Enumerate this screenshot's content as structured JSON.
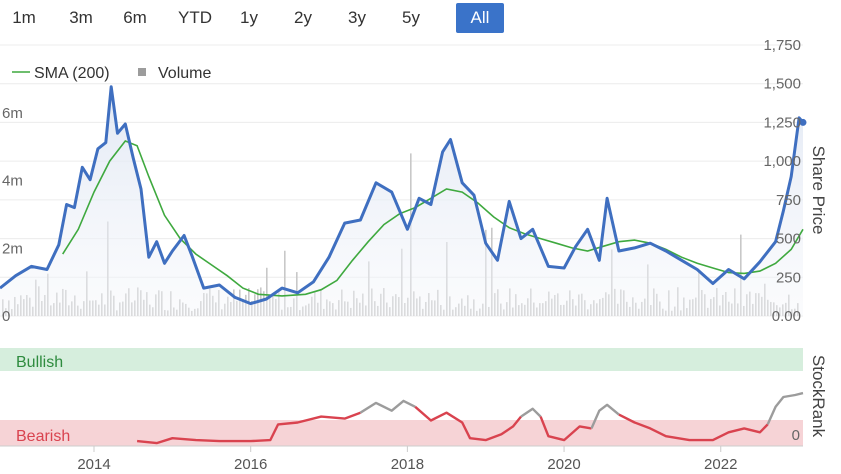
{
  "range_buttons": [
    {
      "label": "1m",
      "active": false
    },
    {
      "label": "3m",
      "active": false
    },
    {
      "label": "6m",
      "active": false
    },
    {
      "label": "YTD",
      "active": false
    },
    {
      "label": "1y",
      "active": false
    },
    {
      "label": "2y",
      "active": false
    },
    {
      "label": "3y",
      "active": false
    },
    {
      "label": "5y",
      "active": false
    },
    {
      "label": "All",
      "active": true
    }
  ],
  "colors": {
    "price": "#3f6fc0",
    "sma": "#3fa93f",
    "volume": "#c8c8c8",
    "bullish_band": "#d6eedd",
    "bearish_band": "#f6d3d6",
    "bullish_text": "#2e8b3e",
    "bearish_text": "#d9434f",
    "rank_red": "#d9434f",
    "rank_gray": "#9c9c9c",
    "active_button": "#3a73c9"
  },
  "chart_data": [
    {
      "type": "line",
      "legend": [
        {
          "name": "SMA (200)",
          "marker": "line"
        },
        {
          "name": "Volume",
          "marker": "square"
        }
      ],
      "legend_position": "top-left",
      "right_axis_title": "Share Price",
      "right_ticks": [
        "1,750",
        "1,500",
        "1,250",
        "1,000",
        "750",
        "500",
        "250",
        "0.00"
      ],
      "left_ticks": [
        "6m",
        "4m",
        "2m",
        "0"
      ],
      "x_ticks": [
        "2014",
        "2016",
        "2018",
        "2020",
        "2022"
      ],
      "ylim_price": [
        0,
        1750
      ],
      "ylim_volume": [
        0,
        8000000
      ],
      "series": [
        {
          "name": "Share Price",
          "points": [
            [
              2012.8,
              180
            ],
            [
              2013.0,
              260
            ],
            [
              2013.2,
              320
            ],
            [
              2013.4,
              300
            ],
            [
              2013.55,
              460
            ],
            [
              2013.65,
              720
            ],
            [
              2013.75,
              700
            ],
            [
              2013.85,
              960
            ],
            [
              2013.95,
              880
            ],
            [
              2014.05,
              1080
            ],
            [
              2014.15,
              1120
            ],
            [
              2014.22,
              1480
            ],
            [
              2014.3,
              1180
            ],
            [
              2014.4,
              1240
            ],
            [
              2014.5,
              1020
            ],
            [
              2014.6,
              820
            ],
            [
              2014.7,
              380
            ],
            [
              2014.8,
              480
            ],
            [
              2014.9,
              340
            ],
            [
              2015.0,
              420
            ],
            [
              2015.15,
              520
            ],
            [
              2015.25,
              390
            ],
            [
              2015.4,
              180
            ],
            [
              2015.6,
              200
            ],
            [
              2015.8,
              120
            ],
            [
              2016.0,
              80
            ],
            [
              2016.2,
              110
            ],
            [
              2016.4,
              180
            ],
            [
              2016.6,
              150
            ],
            [
              2016.8,
              220
            ],
            [
              2017.0,
              380
            ],
            [
              2017.2,
              600
            ],
            [
              2017.4,
              620
            ],
            [
              2017.6,
              860
            ],
            [
              2017.8,
              800
            ],
            [
              2018.0,
              560
            ],
            [
              2018.15,
              760
            ],
            [
              2018.3,
              720
            ],
            [
              2018.45,
              1060
            ],
            [
              2018.55,
              1140
            ],
            [
              2018.7,
              860
            ],
            [
              2018.85,
              780
            ],
            [
              2019.0,
              470
            ],
            [
              2019.15,
              360
            ],
            [
              2019.3,
              740
            ],
            [
              2019.45,
              500
            ],
            [
              2019.6,
              560
            ],
            [
              2019.8,
              320
            ],
            [
              2020.0,
              310
            ],
            [
              2020.15,
              450
            ],
            [
              2020.3,
              560
            ],
            [
              2020.45,
              360
            ],
            [
              2020.55,
              760
            ],
            [
              2020.7,
              420
            ],
            [
              2020.9,
              440
            ],
            [
              2021.1,
              470
            ],
            [
              2021.3,
              420
            ],
            [
              2021.5,
              360
            ],
            [
              2021.7,
              300
            ],
            [
              2021.9,
              210
            ],
            [
              2022.1,
              300
            ],
            [
              2022.3,
              240
            ],
            [
              2022.5,
              350
            ],
            [
              2022.7,
              480
            ],
            [
              2022.8,
              680
            ],
            [
              2022.9,
              900
            ],
            [
              2023.0,
              1280
            ],
            [
              2023.05,
              1250
            ]
          ]
        },
        {
          "name": "SMA (200)",
          "points": [
            [
              2013.6,
              400
            ],
            [
              2013.8,
              560
            ],
            [
              2014.0,
              800
            ],
            [
              2014.2,
              1000
            ],
            [
              2014.4,
              1130
            ],
            [
              2014.55,
              1100
            ],
            [
              2014.7,
              900
            ],
            [
              2014.9,
              650
            ],
            [
              2015.1,
              500
            ],
            [
              2015.3,
              400
            ],
            [
              2015.5,
              330
            ],
            [
              2015.7,
              260
            ],
            [
              2015.9,
              180
            ],
            [
              2016.1,
              140
            ],
            [
              2016.4,
              130
            ],
            [
              2016.7,
              140
            ],
            [
              2016.9,
              170
            ],
            [
              2017.1,
              230
            ],
            [
              2017.3,
              360
            ],
            [
              2017.5,
              480
            ],
            [
              2017.7,
              590
            ],
            [
              2017.9,
              660
            ],
            [
              2018.1,
              700
            ],
            [
              2018.3,
              760
            ],
            [
              2018.5,
              820
            ],
            [
              2018.7,
              800
            ],
            [
              2018.9,
              730
            ],
            [
              2019.1,
              640
            ],
            [
              2019.3,
              570
            ],
            [
              2019.5,
              530
            ],
            [
              2019.7,
              500
            ],
            [
              2019.9,
              470
            ],
            [
              2020.1,
              440
            ],
            [
              2020.3,
              420
            ],
            [
              2020.5,
              450
            ],
            [
              2020.7,
              480
            ],
            [
              2020.9,
              490
            ],
            [
              2021.1,
              470
            ],
            [
              2021.3,
              430
            ],
            [
              2021.5,
              380
            ],
            [
              2021.7,
              340
            ],
            [
              2021.9,
              310
            ],
            [
              2022.1,
              280
            ],
            [
              2022.3,
              275
            ],
            [
              2022.5,
              290
            ],
            [
              2022.7,
              340
            ],
            [
              2022.9,
              430
            ],
            [
              2023.05,
              560
            ]
          ]
        }
      ]
    },
    {
      "type": "line",
      "right_axis_title": "StockRank",
      "band_labels": [
        "Bullish",
        "Bearish"
      ],
      "right_ticks": [
        "0"
      ],
      "ylim": [
        0,
        100
      ],
      "series": [
        {
          "name": "StockRank",
          "segments": [
            {
              "color": "red",
              "points": [
                [
                  2014.55,
                  5
                ],
                [
                  2014.8,
                  3
                ],
                [
                  2015.0,
                  8
                ],
                [
                  2015.3,
                  6
                ],
                [
                  2015.6,
                  5
                ],
                [
                  2016.0,
                  5
                ],
                [
                  2016.25,
                  6
                ],
                [
                  2016.35,
                  22
                ],
                [
                  2016.6,
                  24
                ],
                [
                  2016.9,
                  30
                ],
                [
                  2017.2,
                  28
                ],
                [
                  2017.4,
                  34
                ]
              ]
            },
            {
              "color": "gray",
              "points": [
                [
                  2017.4,
                  34
                ],
                [
                  2017.6,
                  44
                ],
                [
                  2017.8,
                  36
                ],
                [
                  2017.95,
                  46
                ],
                [
                  2018.1,
                  40
                ]
              ]
            },
            {
              "color": "red",
              "points": [
                [
                  2018.1,
                  40
                ],
                [
                  2018.3,
                  26
                ],
                [
                  2018.5,
                  34
                ],
                [
                  2018.7,
                  24
                ],
                [
                  2018.8,
                  8
                ],
                [
                  2019.0,
                  6
                ],
                [
                  2019.2,
                  12
                ],
                [
                  2019.35,
                  20
                ],
                [
                  2019.45,
                  30
                ]
              ]
            },
            {
              "color": "gray",
              "points": [
                [
                  2019.45,
                  30
                ],
                [
                  2019.6,
                  38
                ],
                [
                  2019.7,
                  30
                ]
              ]
            },
            {
              "color": "red",
              "points": [
                [
                  2019.7,
                  30
                ],
                [
                  2019.8,
                  10
                ],
                [
                  2020.0,
                  6
                ],
                [
                  2020.2,
                  20
                ],
                [
                  2020.35,
                  18
                ]
              ]
            },
            {
              "color": "gray",
              "points": [
                [
                  2020.35,
                  18
                ],
                [
                  2020.45,
                  36
                ],
                [
                  2020.55,
                  42
                ],
                [
                  2020.7,
                  32
                ]
              ]
            },
            {
              "color": "red",
              "points": [
                [
                  2020.7,
                  32
                ],
                [
                  2020.9,
                  24
                ],
                [
                  2021.1,
                  18
                ],
                [
                  2021.3,
                  10
                ],
                [
                  2021.6,
                  6
                ],
                [
                  2021.9,
                  6
                ],
                [
                  2022.1,
                  14
                ],
                [
                  2022.3,
                  18
                ],
                [
                  2022.5,
                  14
                ],
                [
                  2022.6,
                  22
                ]
              ]
            },
            {
              "color": "gray",
              "points": [
                [
                  2022.6,
                  22
                ],
                [
                  2022.7,
                  40
                ],
                [
                  2022.8,
                  50
                ],
                [
                  2022.95,
                  52
                ],
                [
                  2023.05,
                  54
                ]
              ]
            }
          ]
        }
      ]
    }
  ]
}
